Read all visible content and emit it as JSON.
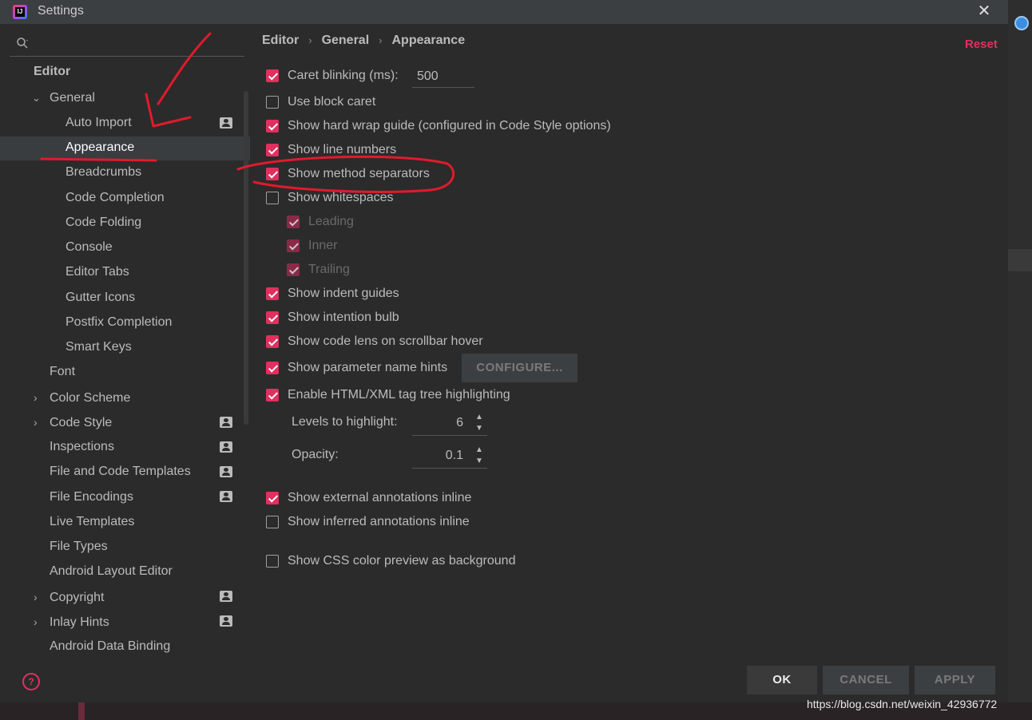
{
  "window": {
    "title": "Settings",
    "close_glyph": "✕",
    "app_logo_text": "IJ"
  },
  "sidebar": {
    "search_placeholder": "",
    "items": [
      {
        "label": "Editor"
      },
      {
        "label": "General"
      },
      {
        "label": "Auto Import"
      },
      {
        "label": "Appearance"
      },
      {
        "label": "Breadcrumbs"
      },
      {
        "label": "Code Completion"
      },
      {
        "label": "Code Folding"
      },
      {
        "label": "Console"
      },
      {
        "label": "Editor Tabs"
      },
      {
        "label": "Gutter Icons"
      },
      {
        "label": "Postfix Completion"
      },
      {
        "label": "Smart Keys"
      },
      {
        "label": "Font"
      },
      {
        "label": "Color Scheme"
      },
      {
        "label": "Code Style"
      },
      {
        "label": "Inspections"
      },
      {
        "label": "File and Code Templates"
      },
      {
        "label": "File Encodings"
      },
      {
        "label": "Live Templates"
      },
      {
        "label": "File Types"
      },
      {
        "label": "Android Layout Editor"
      },
      {
        "label": "Copyright"
      },
      {
        "label": "Inlay Hints"
      },
      {
        "label": "Android Data Binding"
      }
    ],
    "selected": "Appearance",
    "help_glyph": "?"
  },
  "breadcrumb": {
    "parts": [
      "Editor",
      "General",
      "Appearance"
    ],
    "sep": "›"
  },
  "reset_label": "Reset",
  "options": {
    "caret_blinking": {
      "label": "Caret blinking (ms):",
      "checked": true,
      "value": "500"
    },
    "block_caret": {
      "label": "Use block caret",
      "checked": false
    },
    "hard_wrap": {
      "label": "Show hard wrap guide (configured in Code Style options)",
      "checked": true
    },
    "line_numbers": {
      "label": "Show line numbers",
      "checked": true
    },
    "method_separators": {
      "label": "Show method separators",
      "checked": true
    },
    "whitespaces": {
      "label": "Show whitespaces",
      "checked": false
    },
    "leading": {
      "label": "Leading",
      "checked": true,
      "enabled": false
    },
    "inner": {
      "label": "Inner",
      "checked": true,
      "enabled": false
    },
    "trailing": {
      "label": "Trailing",
      "checked": true,
      "enabled": false
    },
    "indent_guides": {
      "label": "Show indent guides",
      "checked": true
    },
    "intention_bulb": {
      "label": "Show intention bulb",
      "checked": true
    },
    "code_lens": {
      "label": "Show code lens on scrollbar hover",
      "checked": true
    },
    "param_hints": {
      "label": "Show parameter name hints",
      "checked": true,
      "button": "CONFIGURE..."
    },
    "html_tag_tree": {
      "label": "Enable HTML/XML tag tree highlighting",
      "checked": true
    },
    "levels": {
      "label": "Levels to highlight:",
      "value": "6"
    },
    "opacity": {
      "label": "Opacity:",
      "value": "0.1"
    },
    "external_annotations": {
      "label": "Show external annotations inline",
      "checked": true
    },
    "inferred_annotations": {
      "label": "Show inferred annotations inline",
      "checked": false
    },
    "css_color_preview": {
      "label": "Show CSS color preview as background",
      "checked": false
    }
  },
  "buttons": {
    "ok": "OK",
    "cancel": "CANCEL",
    "apply": "APPLY"
  },
  "watermark": "https://blog.csdn.net/weixin_42936772",
  "colors": {
    "accent": "#e0305f",
    "background": "#2b2b2b",
    "annotation": "#e01b2b"
  }
}
